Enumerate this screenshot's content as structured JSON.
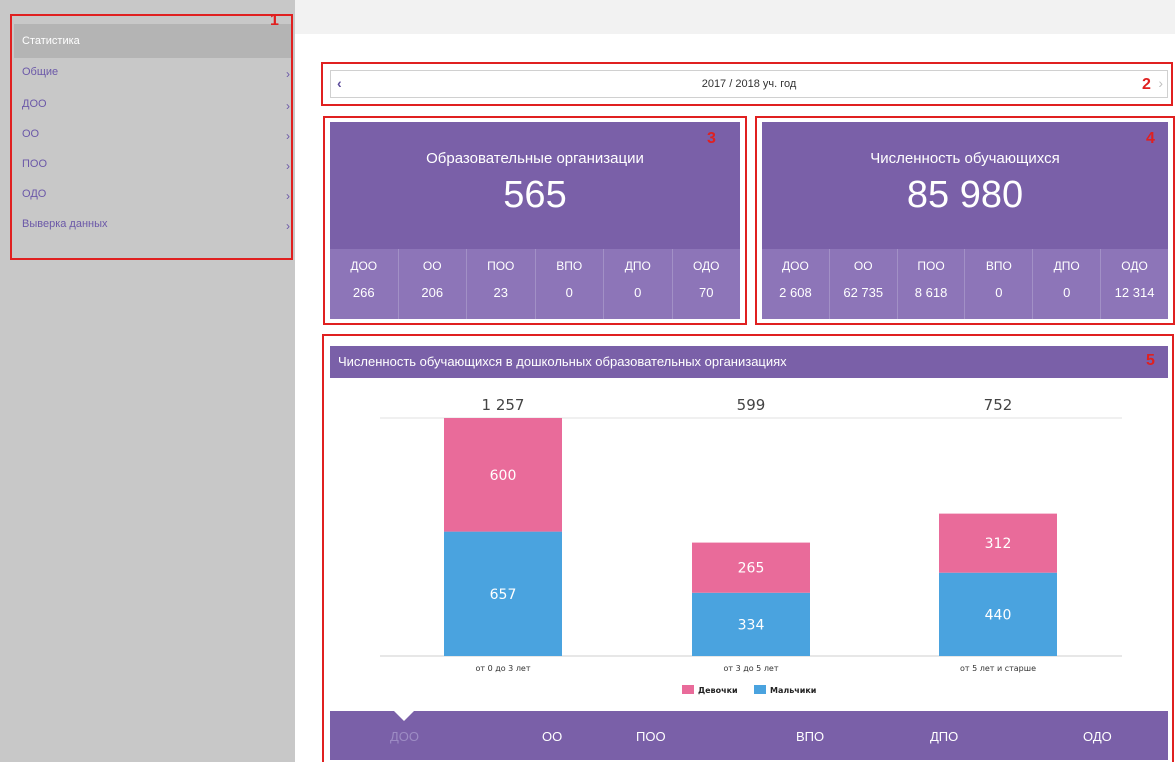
{
  "sidebar": {
    "header": "Статистика",
    "items": [
      {
        "label": "Общие"
      },
      {
        "label": "ДОО"
      },
      {
        "label": "ОО"
      },
      {
        "label": "ПОО"
      },
      {
        "label": "ОДО"
      },
      {
        "label": "Выверка данных"
      }
    ],
    "chevron": "›"
  },
  "annotations": [
    "1",
    "2",
    "3",
    "4",
    "5"
  ],
  "year": {
    "label": "2017 / 2018  уч. год",
    "prev": "‹",
    "next": "›"
  },
  "cards": [
    {
      "title": "Образовательные организации",
      "total": "565",
      "cells": [
        {
          "label": "ДОО",
          "value": "266"
        },
        {
          "label": "ОО",
          "value": "206"
        },
        {
          "label": "ПОО",
          "value": "23"
        },
        {
          "label": "ВПО",
          "value": "0"
        },
        {
          "label": "ДПО",
          "value": "0"
        },
        {
          "label": "ОДО",
          "value": "70"
        }
      ]
    },
    {
      "title": "Численность обучающихся",
      "total": "85 980",
      "cells": [
        {
          "label": "ДОО",
          "value": "2 608"
        },
        {
          "label": "ОО",
          "value": "62 735"
        },
        {
          "label": "ПОО",
          "value": "8 618"
        },
        {
          "label": "ВПО",
          "value": "0"
        },
        {
          "label": "ДПО",
          "value": "0"
        },
        {
          "label": "ОДО",
          "value": "12 314"
        }
      ]
    }
  ],
  "chart": {
    "header": "Численность обучающихся в дошкольных образовательных организациях"
  },
  "chart_data": {
    "type": "bar",
    "stacked": true,
    "categories": [
      "от 0 до 3 лет",
      "от 3 до 5 лет",
      "от 5 лет и старше"
    ],
    "totals": [
      "1 257",
      "599",
      "752"
    ],
    "series": [
      {
        "name": "Мальчики",
        "values": [
          657,
          334,
          440
        ],
        "color": "#4aa3df"
      },
      {
        "name": "Девочки",
        "values": [
          600,
          265,
          312
        ],
        "color": "#e96b9a"
      }
    ],
    "legend": "bottom",
    "grid": false
  },
  "bottom_tabs": [
    {
      "label": "ДОО",
      "active": true
    },
    {
      "label": "ОО"
    },
    {
      "label": "ПОО"
    },
    {
      "label": "ВПО"
    },
    {
      "label": "ДПО"
    },
    {
      "label": "ОДО"
    }
  ]
}
